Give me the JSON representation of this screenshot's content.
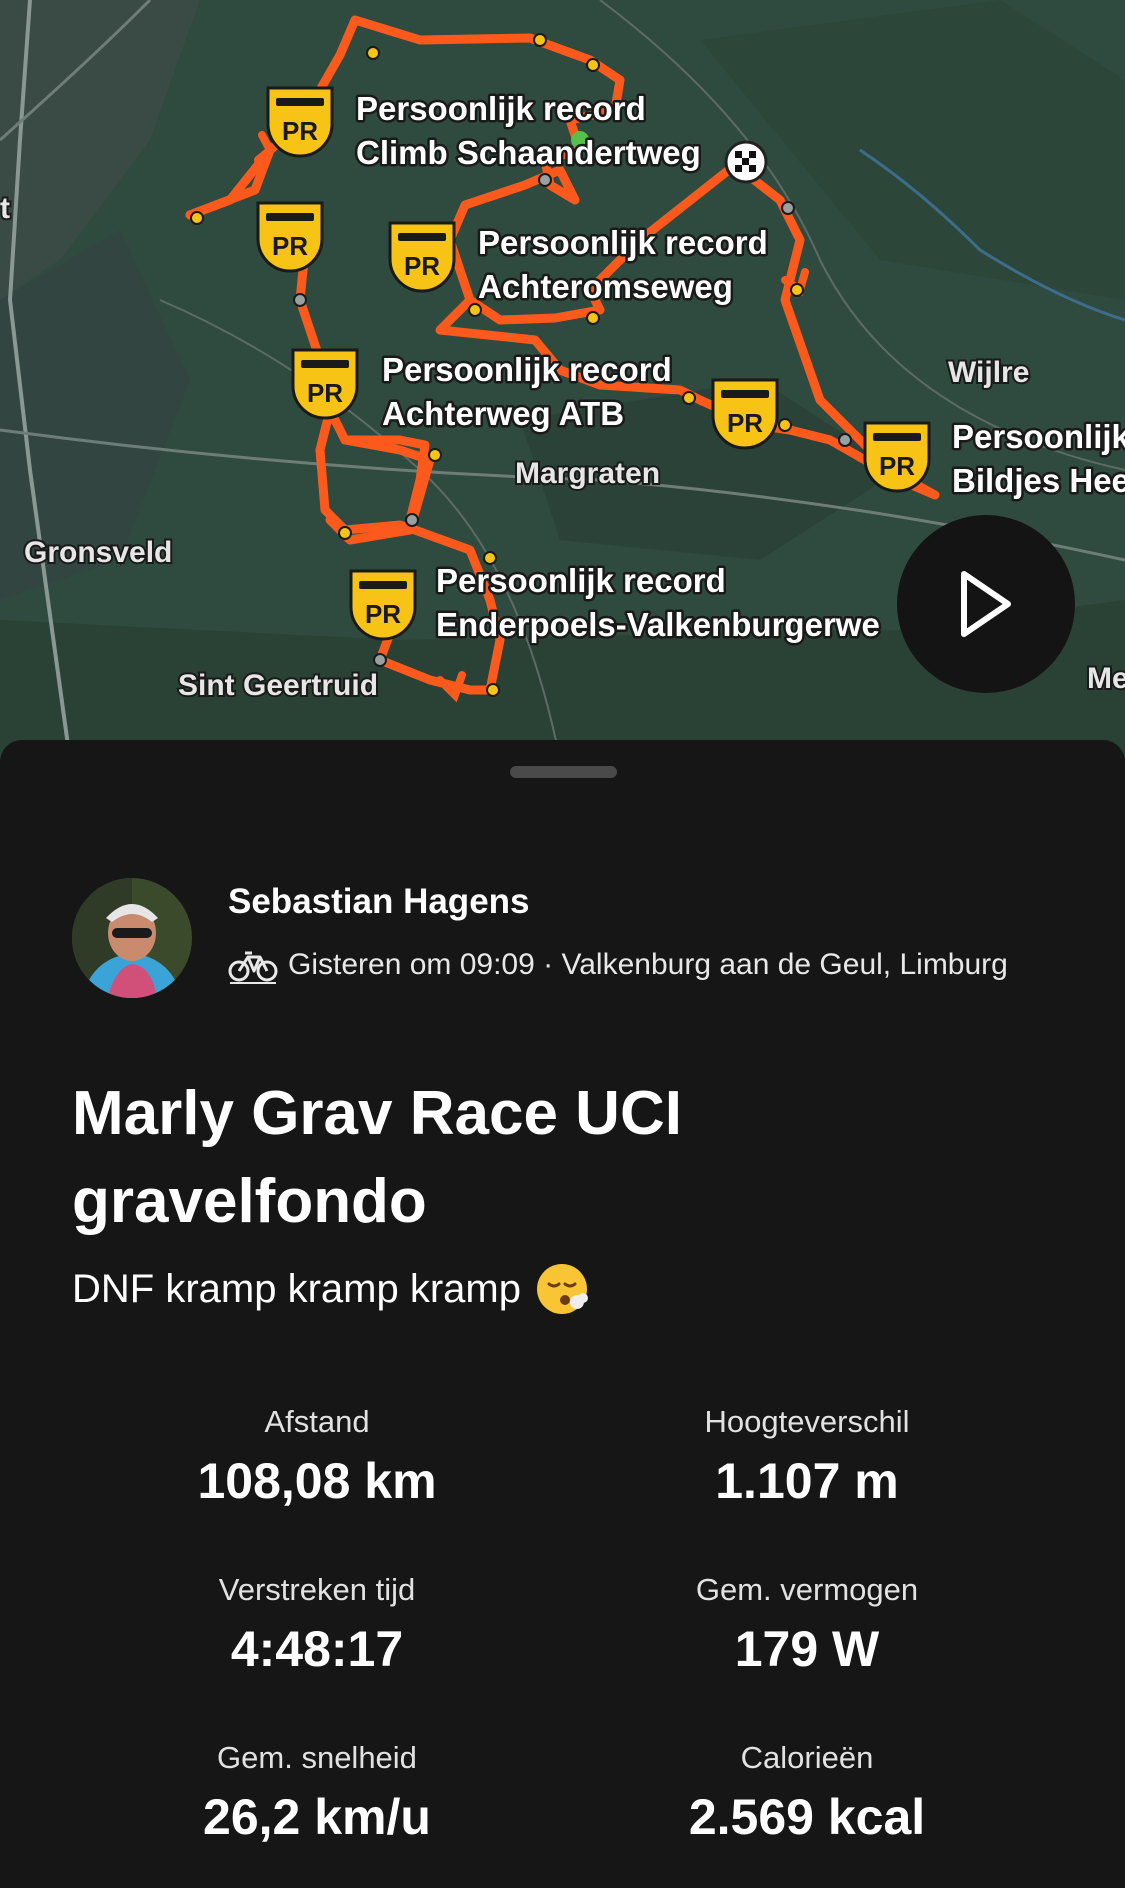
{
  "map": {
    "place_labels": {
      "gronsveld": "Gronsveld",
      "sint_geertruid": "Sint Geertruid",
      "margraten": "Margraten",
      "wijlre": "Wijlre",
      "edge_right": "Me",
      "edge_left": "t"
    },
    "badge_text": "PR",
    "segments": [
      {
        "line1": "Persoonlijk record",
        "line2": "Climb Schaandertweg"
      },
      {
        "line1": "Persoonlijk record",
        "line2": "Achteromseweg"
      },
      {
        "line1": "Persoonlijk record",
        "line2": "Achterweg ATB"
      },
      {
        "line1": "Persoonlijk",
        "line2": "Bildjes Hee"
      },
      {
        "line1": "Persoonlijk record",
        "line2": "Enderpoels-Valkenburgerwe"
      }
    ],
    "route_color": "#fc5a1c",
    "badge_color": "#f7c415",
    "icons": {
      "play": "play-icon",
      "finish": "finish-flag-icon",
      "start": "start-marker-icon"
    }
  },
  "activity": {
    "athlete_name": "Sebastian Hagens",
    "meta": "Gisteren om 09:09 · Valkenburg aan de Geul, Limburg",
    "sport_icon": "bike-icon",
    "title": "Marly Grav Race UCI gravelfondo",
    "description": "DNF kramp kramp kramp",
    "description_emoji": "exhaling-face-emoji"
  },
  "stats": [
    {
      "label": "Afstand",
      "value": "108,08 km"
    },
    {
      "label": "Hoogteverschil",
      "value": "1.107 m"
    },
    {
      "label": "Verstreken tijd",
      "value": "4:48:17"
    },
    {
      "label": "Gem. vermogen",
      "value": "179 W"
    },
    {
      "label": "Gem. snelheid",
      "value": "26,2 km/u"
    },
    {
      "label": "Calorieën",
      "value": "2.569 kcal"
    }
  ]
}
